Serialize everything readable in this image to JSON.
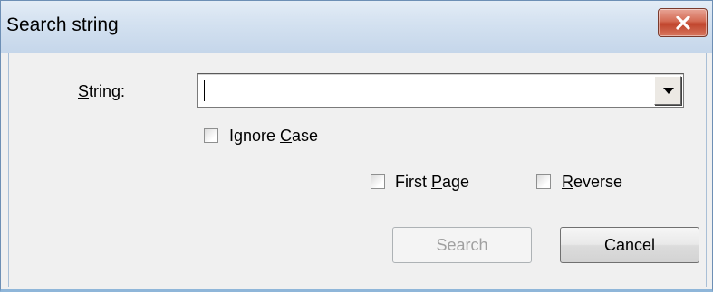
{
  "window": {
    "title": "Search string",
    "close_icon": "close-x-icon"
  },
  "string_field": {
    "label_mnemonic": "S",
    "label_rest": "tring:",
    "value": "",
    "dropdown_icon": "chevron-down-icon"
  },
  "ignore_case": {
    "label_pre": "Ignore ",
    "label_mnemonic": "C",
    "label_rest": "ase",
    "checked": false
  },
  "first_page": {
    "label_pre": "First ",
    "label_mnemonic": "P",
    "label_rest": "age",
    "checked": false
  },
  "reverse": {
    "label_mnemonic": "R",
    "label_rest": "everse",
    "checked": false
  },
  "buttons": {
    "search_label": "Search",
    "cancel_label": "Cancel"
  }
}
